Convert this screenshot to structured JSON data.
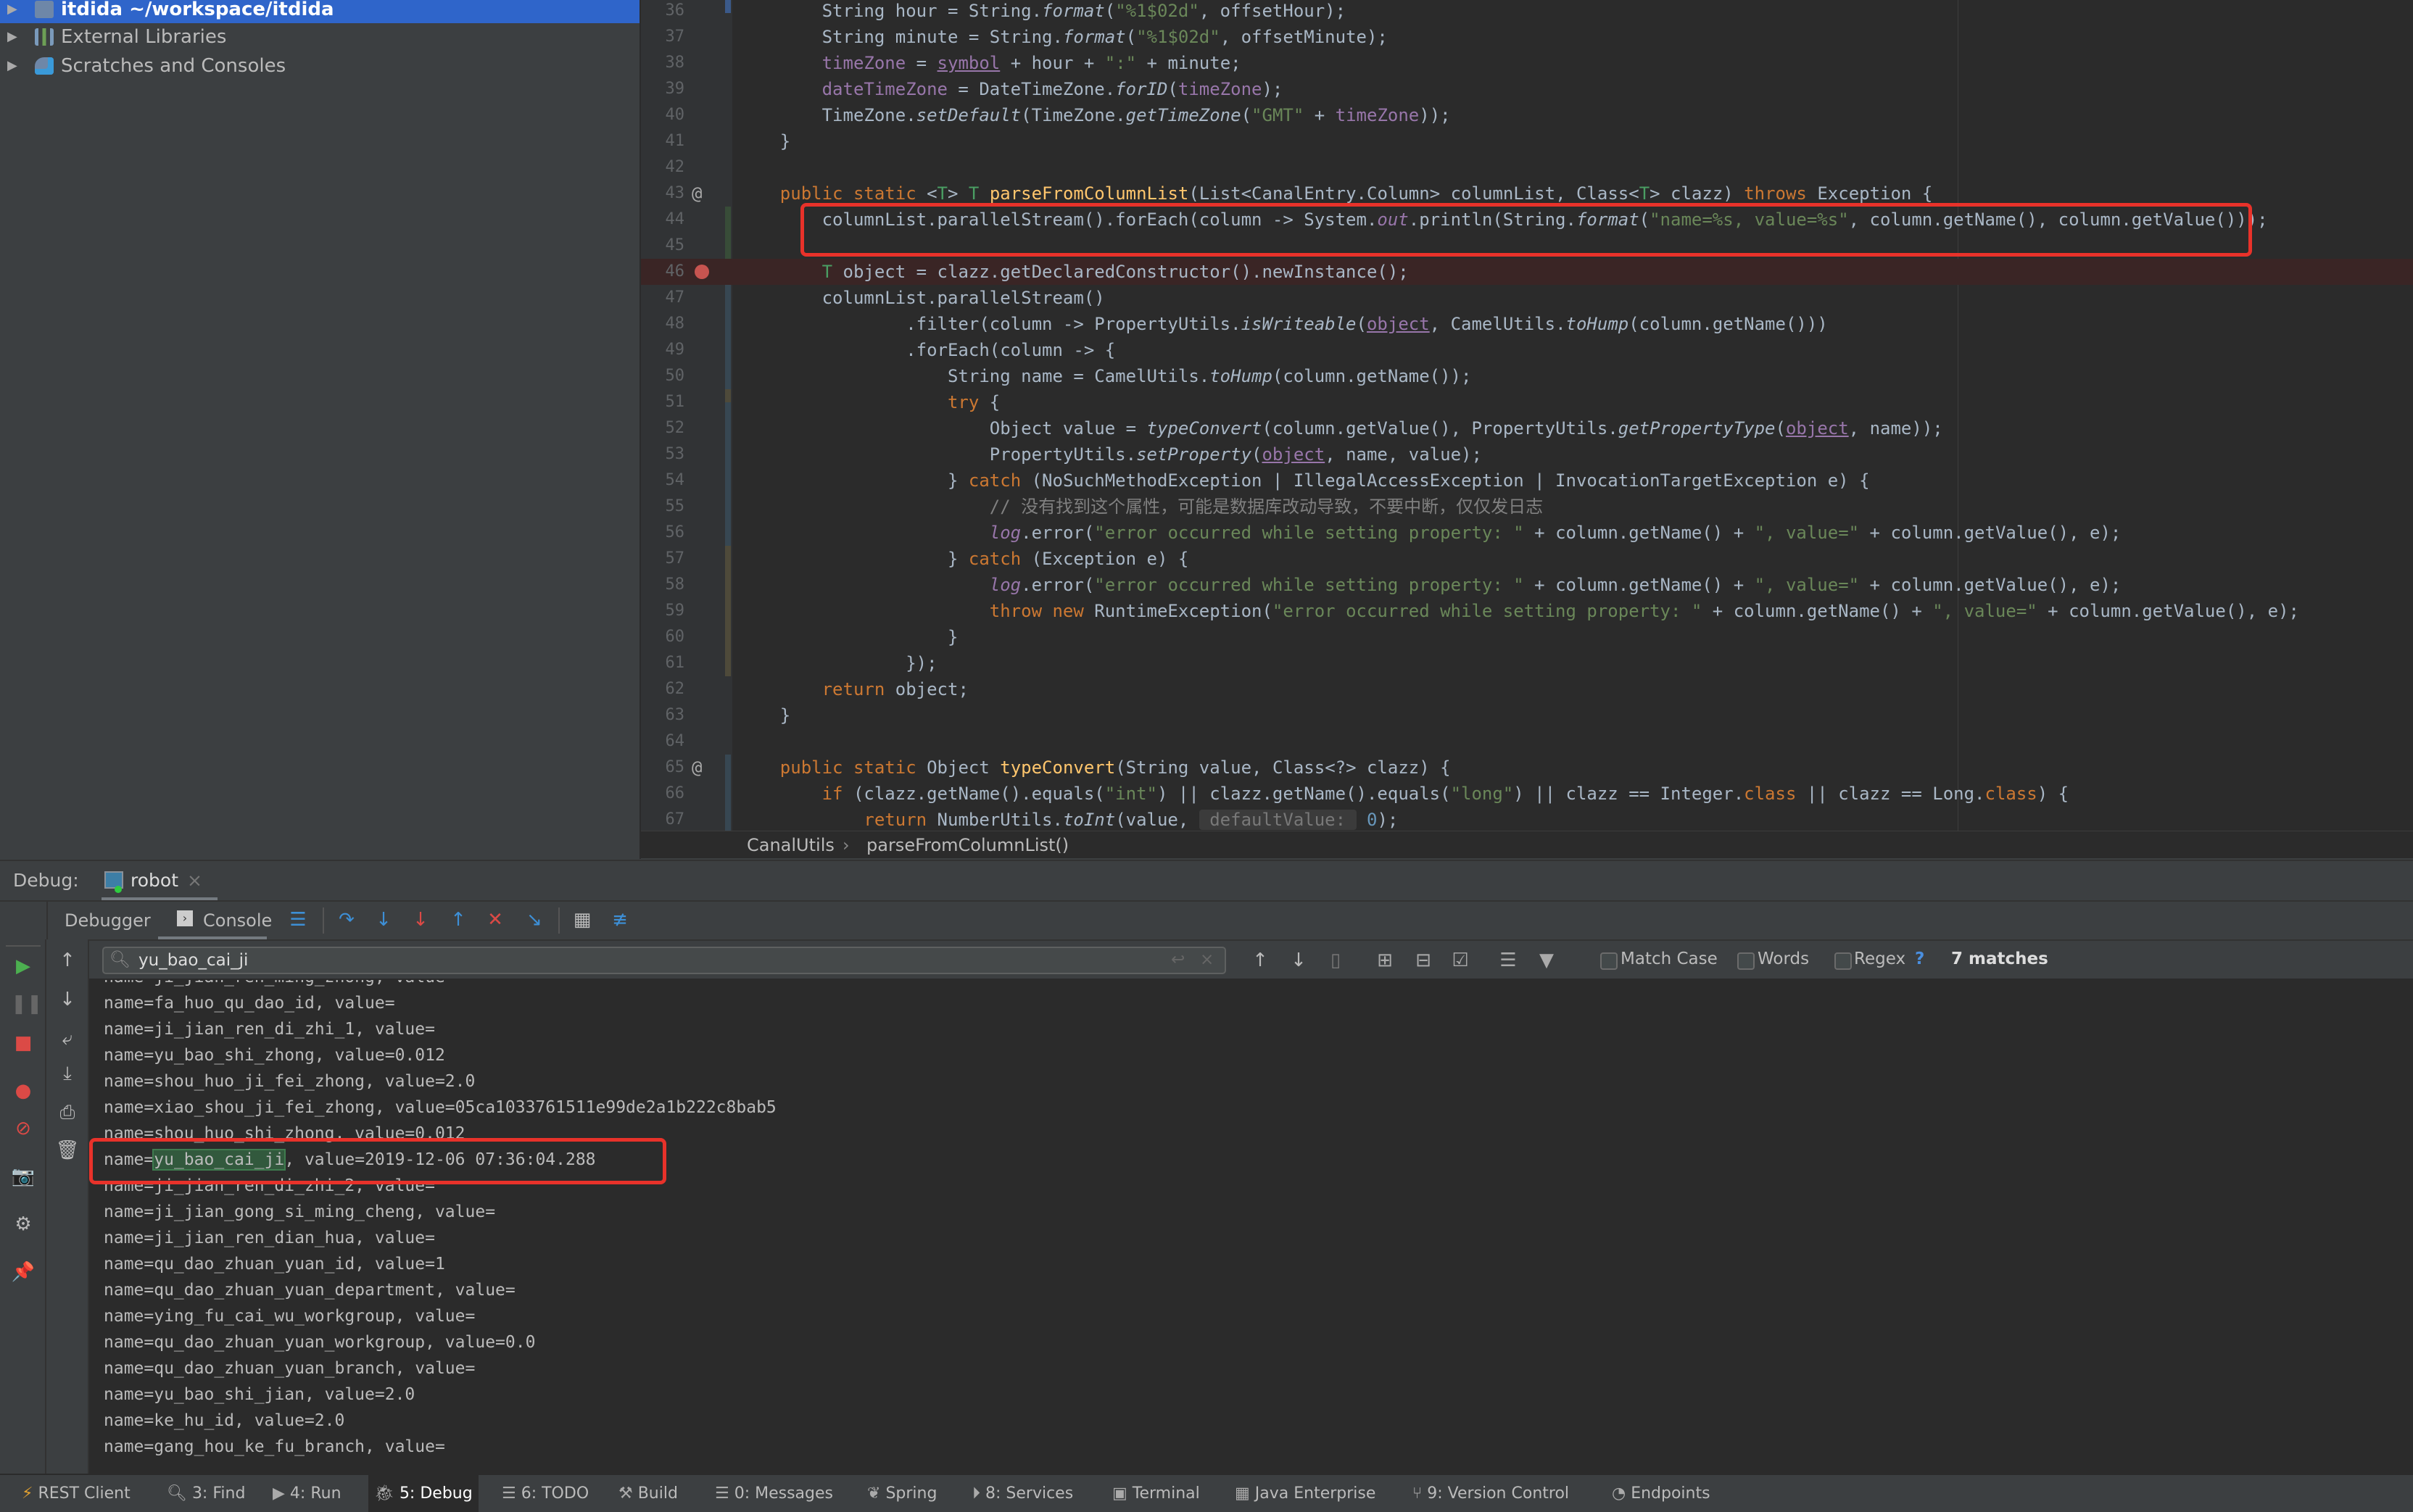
{
  "project": {
    "items": [
      {
        "label": "itdida ~/workspace/itdida",
        "icon": "folder-module-icon",
        "selected": true,
        "expanded": true
      },
      {
        "label": "External Libraries",
        "icon": "library-icon"
      },
      {
        "label": "Scratches and Consoles",
        "icon": "scratches-icon"
      }
    ]
  },
  "editor": {
    "lines": [
      {
        "n": "36",
        "t": [
          [
            "        String hour = String.",
            ""
          ],
          [
            "format",
            "i"
          ],
          [
            "(",
            ""
          ],
          [
            "\"%1$02d\"",
            "s"
          ],
          [
            ", offsetHour);",
            ""
          ]
        ]
      },
      {
        "n": "37",
        "t": [
          [
            "        String minute = String.",
            ""
          ],
          [
            "format",
            "i"
          ],
          [
            "(",
            ""
          ],
          [
            "\"%1$02d\"",
            "s"
          ],
          [
            ", offsetMinute);",
            ""
          ]
        ]
      },
      {
        "n": "38",
        "t": [
          [
            "        ",
            ""
          ],
          [
            "timeZone",
            "f"
          ],
          [
            " = ",
            ""
          ],
          [
            "symbol",
            "u"
          ],
          [
            " + hour + ",
            ""
          ],
          [
            "\":\"",
            "s"
          ],
          [
            " + minute;",
            ""
          ]
        ]
      },
      {
        "n": "39",
        "t": [
          [
            "        ",
            ""
          ],
          [
            "dateTimeZone",
            "f"
          ],
          [
            " = DateTimeZone.",
            ""
          ],
          [
            "forID",
            "i"
          ],
          [
            "(",
            ""
          ],
          [
            "timeZone",
            "f"
          ],
          [
            ");",
            ""
          ]
        ]
      },
      {
        "n": "40",
        "t": [
          [
            "        TimeZone.",
            ""
          ],
          [
            "setDefault",
            "i"
          ],
          [
            "(TimeZone.",
            ""
          ],
          [
            "getTimeZone",
            "i"
          ],
          [
            "(",
            ""
          ],
          [
            "\"GMT\"",
            "s"
          ],
          [
            " + ",
            ""
          ],
          [
            "timeZone",
            "f"
          ],
          [
            "));",
            ""
          ]
        ]
      },
      {
        "n": "41",
        "t": [
          [
            "    }",
            ""
          ]
        ]
      },
      {
        "n": "42",
        "t": []
      },
      {
        "n": "43",
        "mark": "@",
        "t": [
          [
            "    ",
            ""
          ],
          [
            "public static ",
            "k"
          ],
          [
            "<",
            ""
          ],
          [
            "T",
            "g"
          ],
          [
            "> ",
            ""
          ],
          [
            "T ",
            "g"
          ],
          [
            "parseFromColumnList",
            "m"
          ],
          [
            "(List<CanalEntry.Column> columnList, Class<",
            ""
          ],
          [
            "T",
            "g"
          ],
          [
            "> clazz) ",
            ""
          ],
          [
            "throws",
            "k"
          ],
          [
            " Exception {",
            ""
          ]
        ]
      },
      {
        "n": "44",
        "t": [
          [
            "        columnList.parallelStream().forEach(column -> System.",
            ""
          ],
          [
            "out",
            "fi"
          ],
          [
            ".println(String.",
            ""
          ],
          [
            "format",
            "i"
          ],
          [
            "(",
            ""
          ],
          [
            "\"name=%s, value=%s\"",
            "s"
          ],
          [
            ", column.getName(), column.getValue()));",
            ""
          ]
        ]
      },
      {
        "n": "45",
        "t": []
      },
      {
        "n": "46",
        "breakpoint": true,
        "t": [
          [
            "        ",
            ""
          ],
          [
            "T",
            "g"
          ],
          [
            " object = clazz.getDeclaredConstructor().newInstance();",
            ""
          ]
        ]
      },
      {
        "n": "47",
        "t": [
          [
            "        columnList.parallelStream()",
            ""
          ]
        ]
      },
      {
        "n": "48",
        "t": [
          [
            "                .filter(column -> PropertyUtils.",
            ""
          ],
          [
            "isWriteable",
            "i"
          ],
          [
            "(",
            ""
          ],
          [
            "object",
            "u"
          ],
          [
            ", CamelUtils.",
            ""
          ],
          [
            "toHump",
            "i"
          ],
          [
            "(column.getName()))",
            ""
          ]
        ]
      },
      {
        "n": "49",
        "t": [
          [
            "                .forEach(column -> {",
            ""
          ]
        ]
      },
      {
        "n": "50",
        "t": [
          [
            "                    String name = CamelUtils.",
            ""
          ],
          [
            "toHump",
            "i"
          ],
          [
            "(column.getName());",
            ""
          ]
        ]
      },
      {
        "n": "51",
        "t": [
          [
            "                    ",
            ""
          ],
          [
            "try",
            "k"
          ],
          [
            " {",
            ""
          ]
        ]
      },
      {
        "n": "52",
        "t": [
          [
            "                        Object value = ",
            ""
          ],
          [
            "typeConvert",
            "i"
          ],
          [
            "(column.getValue(), PropertyUtils.",
            ""
          ],
          [
            "getPropertyType",
            "i"
          ],
          [
            "(",
            ""
          ],
          [
            "object",
            "u"
          ],
          [
            ", name));",
            ""
          ]
        ]
      },
      {
        "n": "53",
        "t": [
          [
            "                        PropertyUtils.",
            ""
          ],
          [
            "setProperty",
            "i"
          ],
          [
            "(",
            ""
          ],
          [
            "object",
            "u"
          ],
          [
            ", name, value);",
            ""
          ]
        ]
      },
      {
        "n": "54",
        "t": [
          [
            "                    } ",
            ""
          ],
          [
            "catch",
            "k"
          ],
          [
            " (NoSuchMethodException | IllegalAccessException | InvocationTargetException e) {",
            ""
          ]
        ]
      },
      {
        "n": "55",
        "t": [
          [
            "                        ",
            ""
          ],
          [
            "// 没有找到这个属性，可能是数据库改动导致，不要中断，仅仅发日志",
            "c"
          ]
        ]
      },
      {
        "n": "56",
        "t": [
          [
            "                        ",
            ""
          ],
          [
            "log",
            "fi"
          ],
          [
            ".error(",
            ""
          ],
          [
            "\"error occurred while setting property: \"",
            "s"
          ],
          [
            " + column.getName() + ",
            ""
          ],
          [
            "\", value=\"",
            "s"
          ],
          [
            " + column.getValue(), e);",
            ""
          ]
        ]
      },
      {
        "n": "57",
        "t": [
          [
            "                    } ",
            ""
          ],
          [
            "catch",
            "k"
          ],
          [
            " (Exception e) {",
            ""
          ]
        ]
      },
      {
        "n": "58",
        "t": [
          [
            "                        ",
            ""
          ],
          [
            "log",
            "fi"
          ],
          [
            ".error(",
            ""
          ],
          [
            "\"error occurred while setting property: \"",
            "s"
          ],
          [
            " + column.getName() + ",
            ""
          ],
          [
            "\", value=\"",
            "s"
          ],
          [
            " + column.getValue(), e);",
            ""
          ]
        ]
      },
      {
        "n": "59",
        "t": [
          [
            "                        ",
            ""
          ],
          [
            "throw new ",
            "k"
          ],
          [
            "RuntimeException(",
            ""
          ],
          [
            "\"error occurred while setting property: \"",
            "s"
          ],
          [
            " + column.getName() + ",
            ""
          ],
          [
            "\", value=\"",
            "s"
          ],
          [
            " + column.getValue(), e);",
            ""
          ]
        ]
      },
      {
        "n": "60",
        "t": [
          [
            "                    }",
            ""
          ]
        ]
      },
      {
        "n": "61",
        "t": [
          [
            "                });",
            ""
          ]
        ]
      },
      {
        "n": "62",
        "t": [
          [
            "        ",
            ""
          ],
          [
            "return",
            "k"
          ],
          [
            " object;",
            ""
          ]
        ]
      },
      {
        "n": "63",
        "t": [
          [
            "    }",
            ""
          ]
        ]
      },
      {
        "n": "64",
        "t": []
      },
      {
        "n": "65",
        "mark": "@",
        "t": [
          [
            "    ",
            ""
          ],
          [
            "public static ",
            "k"
          ],
          [
            "Object ",
            ""
          ],
          [
            "typeConvert",
            "m"
          ],
          [
            "(String value, Class<?> clazz) {",
            ""
          ]
        ]
      },
      {
        "n": "66",
        "t": [
          [
            "        ",
            ""
          ],
          [
            "if",
            "k"
          ],
          [
            " (clazz.getName().equals(",
            ""
          ],
          [
            "\"int\"",
            "s"
          ],
          [
            ") || clazz.getName().equals(",
            ""
          ],
          [
            "\"long\"",
            "s"
          ],
          [
            ") || clazz == Integer.",
            ""
          ],
          [
            "class",
            "k"
          ],
          [
            " || clazz == Long.",
            ""
          ],
          [
            "class",
            "k"
          ],
          [
            ") {",
            ""
          ]
        ]
      },
      {
        "n": "67",
        "t": [
          [
            "            ",
            ""
          ],
          [
            "return",
            "k"
          ],
          [
            " NumberUtils.",
            ""
          ],
          [
            "toInt",
            "i"
          ],
          [
            "(value, ",
            ""
          ],
          [
            " defaultValue: ",
            "h"
          ],
          [
            " ",
            ""
          ],
          [
            "0",
            "n"
          ],
          [
            ");",
            ""
          ]
        ]
      }
    ]
  },
  "breadcrumb": {
    "class_name": "CanalUtils",
    "separator": "›",
    "method_name": "parseFromColumnList()"
  },
  "debug": {
    "label": "Debug:",
    "session_tab": "robot",
    "close": "×",
    "tabs": {
      "debugger": "Debugger",
      "console": "Console"
    },
    "search": {
      "value": "yu_bao_cai_ji",
      "match_case": "Match Case",
      "words": "Words",
      "regex": "Regex",
      "help": "?",
      "matches": "7 matches"
    },
    "console_lines": [
      {
        "text": "name=ji_jian_ren_ming_zhong, value="
      },
      {
        "text": "name=fa_huo_qu_dao_id, value="
      },
      {
        "text": "name=ji_jian_ren_di_zhi_1, value="
      },
      {
        "text": "name=yu_bao_shi_zhong, value=0.012"
      },
      {
        "text": "name=shou_huo_ji_fei_zhong, value=2.0"
      },
      {
        "text": "name=xiao_shou_ji_fei_zhong, value=05ca1033761511e99de2a1b222c8bab5"
      },
      {
        "text": "name=shou_huo_shi_zhong, value=0.012"
      },
      {
        "pre": "name=",
        "match": "yu_bao_cai_ji",
        "post": ", value=2019-12-06 07:36:04.288"
      },
      {
        "text": "name=ji_jian_ren_di_zhi_2, value="
      },
      {
        "text": "name=ji_jian_gong_si_ming_cheng, value="
      },
      {
        "text": "name=ji_jian_ren_dian_hua, value="
      },
      {
        "text": "name=qu_dao_zhuan_yuan_id, value=1"
      },
      {
        "text": "name=qu_dao_zhuan_yuan_department, value="
      },
      {
        "text": "name=ying_fu_cai_wu_workgroup, value="
      },
      {
        "text": "name=qu_dao_zhuan_yuan_workgroup, value=0.0"
      },
      {
        "text": "name=qu_dao_zhuan_yuan_branch, value="
      },
      {
        "text": "name=yu_bao_shi_jian, value=2.0"
      },
      {
        "text": "name=ke_hu_id, value=2.0"
      },
      {
        "text": "name=gang_hou_ke_fu_branch, value="
      }
    ]
  },
  "statusbar": {
    "items": [
      {
        "label": "REST Client",
        "icon": "rest-client-icon"
      },
      {
        "label": "3: Find",
        "icon": "search-icon"
      },
      {
        "label": "4: Run",
        "icon": "run-icon"
      },
      {
        "label": "5: Debug",
        "icon": "debug-icon",
        "active": true
      },
      {
        "label": "6: TODO",
        "icon": "todo-icon"
      },
      {
        "label": "Build",
        "icon": "build-icon"
      },
      {
        "label": "0: Messages",
        "icon": "messages-icon"
      },
      {
        "label": "Spring",
        "icon": "spring-icon"
      },
      {
        "label": "8: Services",
        "icon": "services-icon"
      },
      {
        "label": "Terminal",
        "icon": "terminal-icon"
      },
      {
        "label": "Java Enterprise",
        "icon": "java-enterprise-icon"
      },
      {
        "label": "9: Version Control",
        "icon": "version-control-icon"
      },
      {
        "label": "Endpoints",
        "icon": "endpoints-icon"
      }
    ]
  },
  "colors": {
    "accent": "#2f65ca",
    "annotation_red": "#e8322a",
    "match_highlight": "#32593d",
    "breakpoint": "#c75450"
  }
}
